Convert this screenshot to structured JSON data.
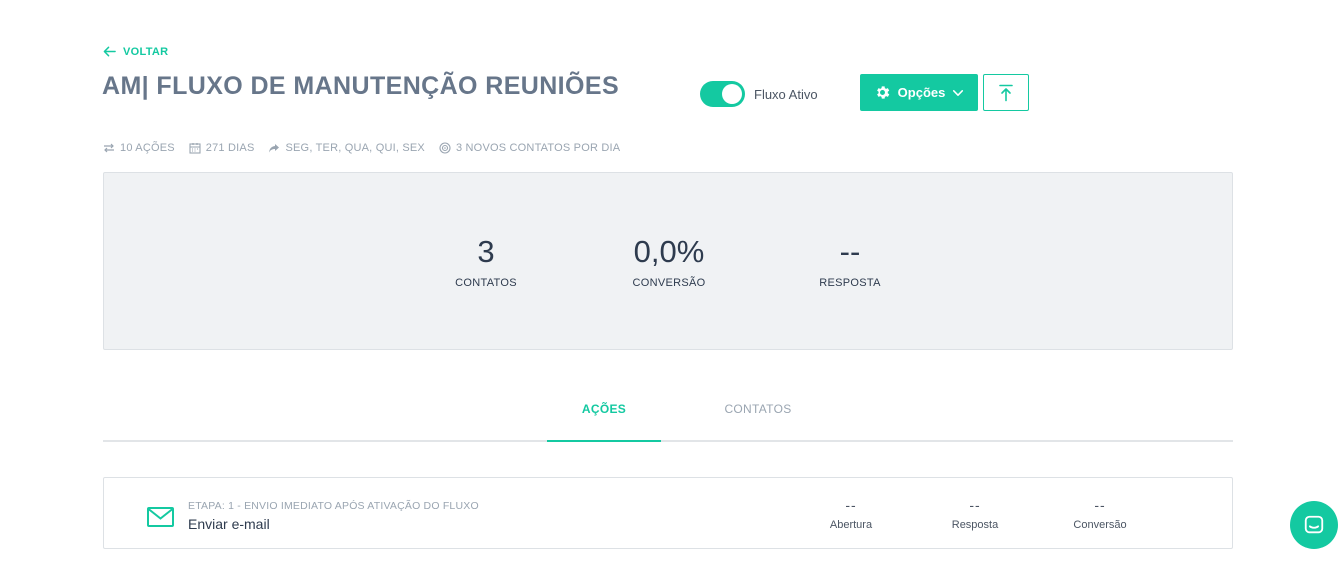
{
  "nav": {
    "back_label": "VOLTAR"
  },
  "header": {
    "title": "AM| FLUXO DE MANUTENÇÃO REUNIÕES",
    "toggle_label": "Fluxo Ativo",
    "toggle_on": true,
    "options_label": "Opções"
  },
  "meta": {
    "actions": "10 AÇÕES",
    "days": "271 DIAS",
    "weekdays": "SEG, TER, QUA, QUI, SEX",
    "new_contacts": "3 NOVOS CONTATOS POR DIA"
  },
  "stats": [
    {
      "value": "3",
      "label": "CONTATOS"
    },
    {
      "value": "0,0%",
      "label": "CONVERSÃO"
    },
    {
      "value": "--",
      "label": "RESPOSTA"
    }
  ],
  "tabs": [
    {
      "label": "AÇÕES",
      "active": true
    },
    {
      "label": "CONTATOS",
      "active": false
    }
  ],
  "steps": [
    {
      "etapa": "ETAPA: 1 - ENVIO IMEDIATO APÓS ATIVAÇÃO DO FLUXO",
      "name": "Enviar e-mail",
      "icon": "mail-icon",
      "metrics": [
        {
          "value": "--",
          "label": "Abertura"
        },
        {
          "value": "--",
          "label": "Resposta"
        },
        {
          "value": "--",
          "label": "Conversão"
        }
      ]
    }
  ],
  "colors": {
    "accent": "#14c9a1",
    "text": "#2e3b4e",
    "muted": "#9aa5b1",
    "panel": "#f0f2f4"
  }
}
